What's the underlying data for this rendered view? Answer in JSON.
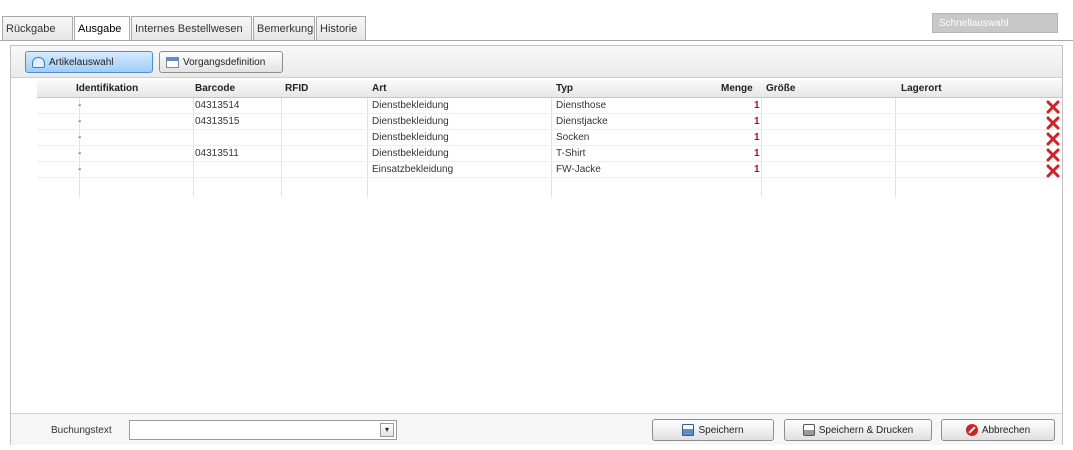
{
  "tabs": [
    {
      "label": "Rückgabe",
      "active": false
    },
    {
      "label": "Ausgabe",
      "active": true
    },
    {
      "label": "Internes Bestellwesen",
      "active": false
    },
    {
      "label": "Bemerkung",
      "active": false
    },
    {
      "label": "Historie",
      "active": false
    }
  ],
  "quick_search": {
    "placeholder": "Schnellauswahl"
  },
  "toolbar": {
    "artikelauswahl_label": "Artikelauswahl",
    "vorgangsdefinition_label": "Vorgangsdefinition"
  },
  "grid": {
    "columns": [
      "Identifikation",
      "Barcode",
      "RFID",
      "Art",
      "Typ",
      "Menge",
      "Größe",
      "Lagerort"
    ],
    "rows": [
      {
        "identifikation": "-",
        "barcode": "04313514",
        "rfid": "",
        "art": "Dienstbekleidung",
        "typ": "Diensthose",
        "menge": "1",
        "groesse": "",
        "lagerort": ""
      },
      {
        "identifikation": "-",
        "barcode": "04313515",
        "rfid": "",
        "art": "Dienstbekleidung",
        "typ": "Dienstjacke",
        "menge": "1",
        "groesse": "",
        "lagerort": ""
      },
      {
        "identifikation": "-",
        "barcode": "",
        "rfid": "",
        "art": "Dienstbekleidung",
        "typ": "Socken",
        "menge": "1",
        "groesse": "",
        "lagerort": ""
      },
      {
        "identifikation": "-",
        "barcode": "04313511",
        "rfid": "",
        "art": "Dienstbekleidung",
        "typ": "T-Shirt",
        "menge": "1",
        "groesse": "",
        "lagerort": ""
      },
      {
        "identifikation": "-",
        "barcode": "",
        "rfid": "",
        "art": "Einsatzbekleidung",
        "typ": "FW-Jacke",
        "menge": "1",
        "groesse": "",
        "lagerort": ""
      }
    ]
  },
  "bottom": {
    "buchungstext_label": "Buchungstext",
    "buchungstext_value": "",
    "save_label": "Speichern",
    "save_print_label": "Speichern & Drucken",
    "cancel_label": "Abbrechen"
  },
  "icons": {
    "artikelauswahl": "cloud-icon",
    "vorgangsdefinition": "calendar-icon",
    "delete": "delete-x-icon",
    "save": "floppy-disk-icon",
    "print": "printer-icon",
    "cancel": "stop-icon",
    "dropdown": "chevron-down-icon"
  },
  "colors": {
    "quantity": "#d40000",
    "delete": "#d42020",
    "selected_button": "#9fcdf6"
  }
}
